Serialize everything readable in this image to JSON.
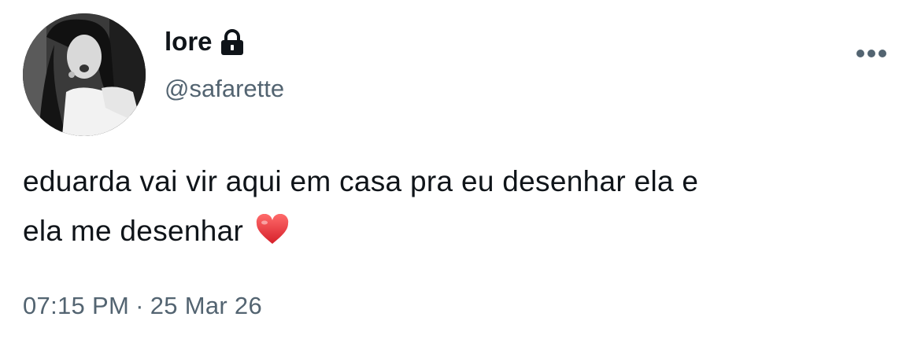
{
  "user": {
    "display_name": "lore",
    "handle": "@safarette",
    "protected_icon": "lock-icon",
    "avatar_icon": "profile-photo"
  },
  "tweet": {
    "text_line1": "eduarda vai vir aqui em casa pra eu desenhar ela e",
    "text_line2": "ela me desenhar",
    "emoji": "heart-icon",
    "time": "07:15 PM",
    "separator": "·",
    "date": "25 Mar 26"
  },
  "actions": {
    "more_icon": "more-horizontal-icon"
  },
  "colors": {
    "text": "#0f1419",
    "secondary": "#536471",
    "heart": "#e0245e",
    "background": "#ffffff"
  }
}
